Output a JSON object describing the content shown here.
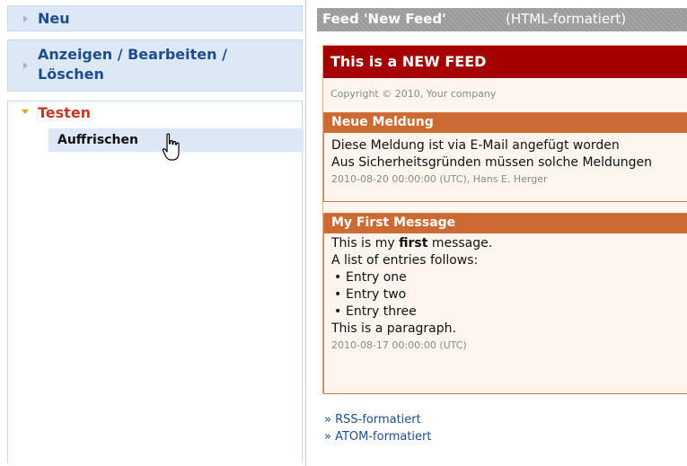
{
  "sidebar": {
    "items": [
      {
        "label": "Neu"
      },
      {
        "label_line1": "Anzeigen / Bearbeiten /",
        "label_line2": "Löschen"
      },
      {
        "label": "Testen",
        "subitems": [
          {
            "label": "Auffrischen"
          }
        ]
      }
    ]
  },
  "feed_header": {
    "title": "Feed 'New Feed'",
    "format": "(HTML-formatiert)"
  },
  "feed": {
    "title": "This is a NEW FEED",
    "copyright": "Copyright © 2010, Your company",
    "messages": [
      {
        "title": "Neue Meldung",
        "line1": "Diese Meldung ist via E-Mail angefügt worden",
        "line2": "Aus Sicherheitsgründen müssen solche Meldungen",
        "meta": "2010-08-20 00:00:00 (UTC), Hans E. Herger"
      },
      {
        "title": "My First Message",
        "intro_prefix": "This is my ",
        "intro_bold": "first",
        "intro_suffix": " message.",
        "list_intro": "A list of entries follows:",
        "entries": [
          "Entry one",
          "Entry two",
          "Entry three"
        ],
        "paragraph": "This is a paragraph.",
        "meta": "2010-08-17 00:00:00 (UTC)"
      }
    ]
  },
  "links": {
    "rss": "» RSS-formatiert",
    "atom": "» ATOM-formatiert"
  },
  "colors": {
    "nav_bg": "#dce8f6",
    "nav_text": "#1f4d8c",
    "active_text": "#c0392b",
    "feed_title_bg": "#a40000",
    "message_head_bg": "#cd6a33"
  }
}
